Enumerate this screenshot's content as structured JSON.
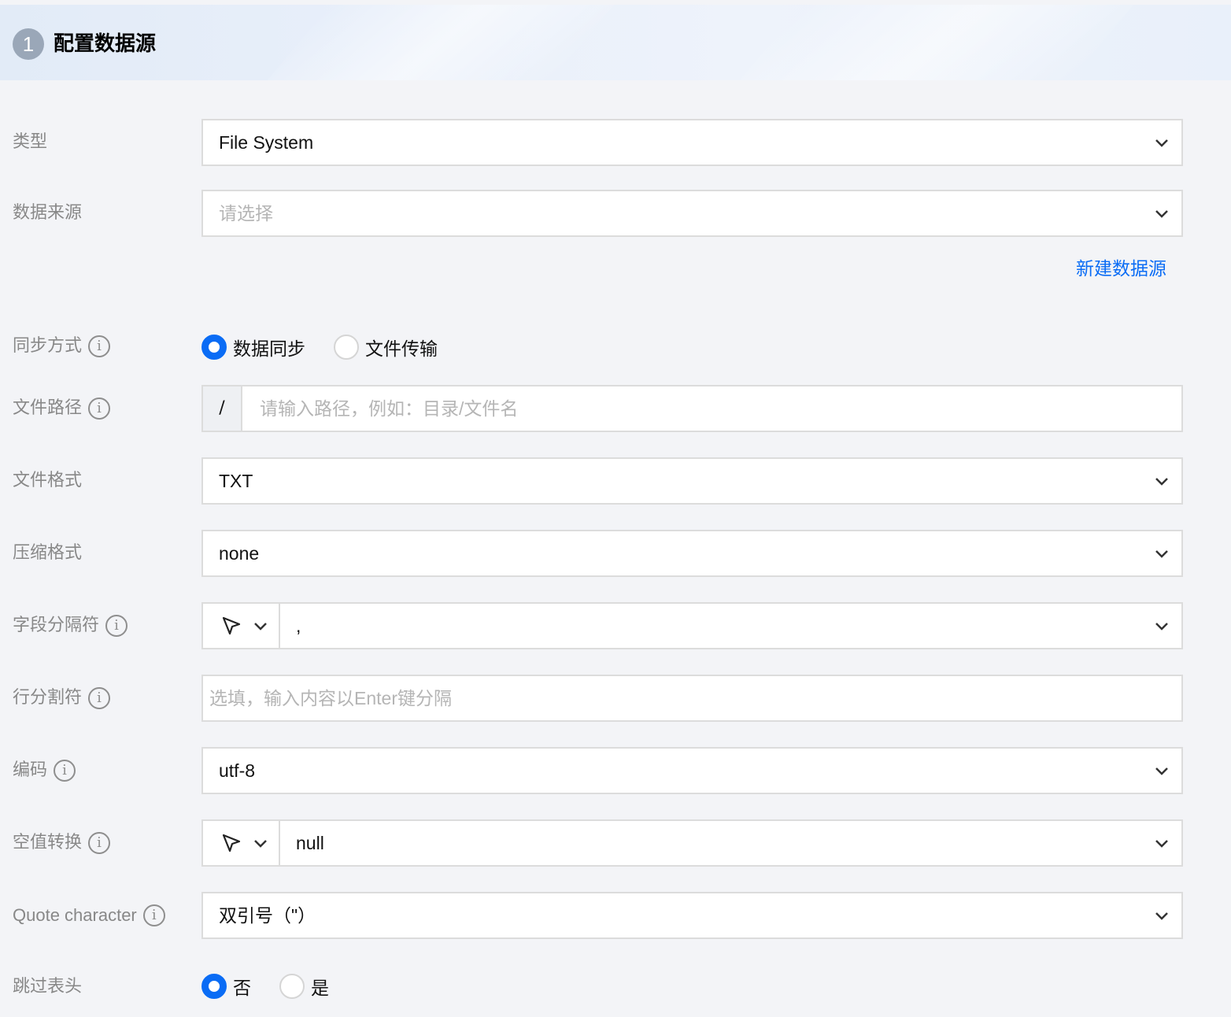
{
  "header": {
    "step": "1",
    "title": "配置数据源"
  },
  "form": {
    "type": {
      "label": "类型",
      "value": "File System"
    },
    "source": {
      "label": "数据来源",
      "placeholder": "请选择",
      "new_link": "新建数据源"
    },
    "sync_mode": {
      "label": "同步方式",
      "options": [
        "数据同步",
        "文件传输"
      ],
      "selected": "数据同步"
    },
    "file_path": {
      "label": "文件路径",
      "prefix": "/",
      "placeholder": "请输入路径，例如：目录/文件名"
    },
    "file_format": {
      "label": "文件格式",
      "value": "TXT"
    },
    "compression": {
      "label": "压缩格式",
      "value": "none"
    },
    "field_delimiter": {
      "label": "字段分隔符",
      "value": ","
    },
    "line_delimiter": {
      "label": "行分割符",
      "placeholder": "选填，输入内容以Enter键分隔"
    },
    "encoding": {
      "label": "编码",
      "value": "utf-8"
    },
    "null_conversion": {
      "label": "空值转换",
      "value": "null"
    },
    "quote_character": {
      "label": "Quote character",
      "value": "双引号（\"）"
    },
    "skip_header": {
      "label": "跳过表头",
      "options": [
        "否",
        "是"
      ],
      "selected": "否"
    }
  },
  "icons": {
    "info": "info-circle-icon",
    "chevron": "chevron-down-icon",
    "cursor": "cursor-pointer-icon"
  },
  "colors": {
    "accent": "#0a6cf5",
    "label": "#888888",
    "border": "#dcdcdc"
  }
}
